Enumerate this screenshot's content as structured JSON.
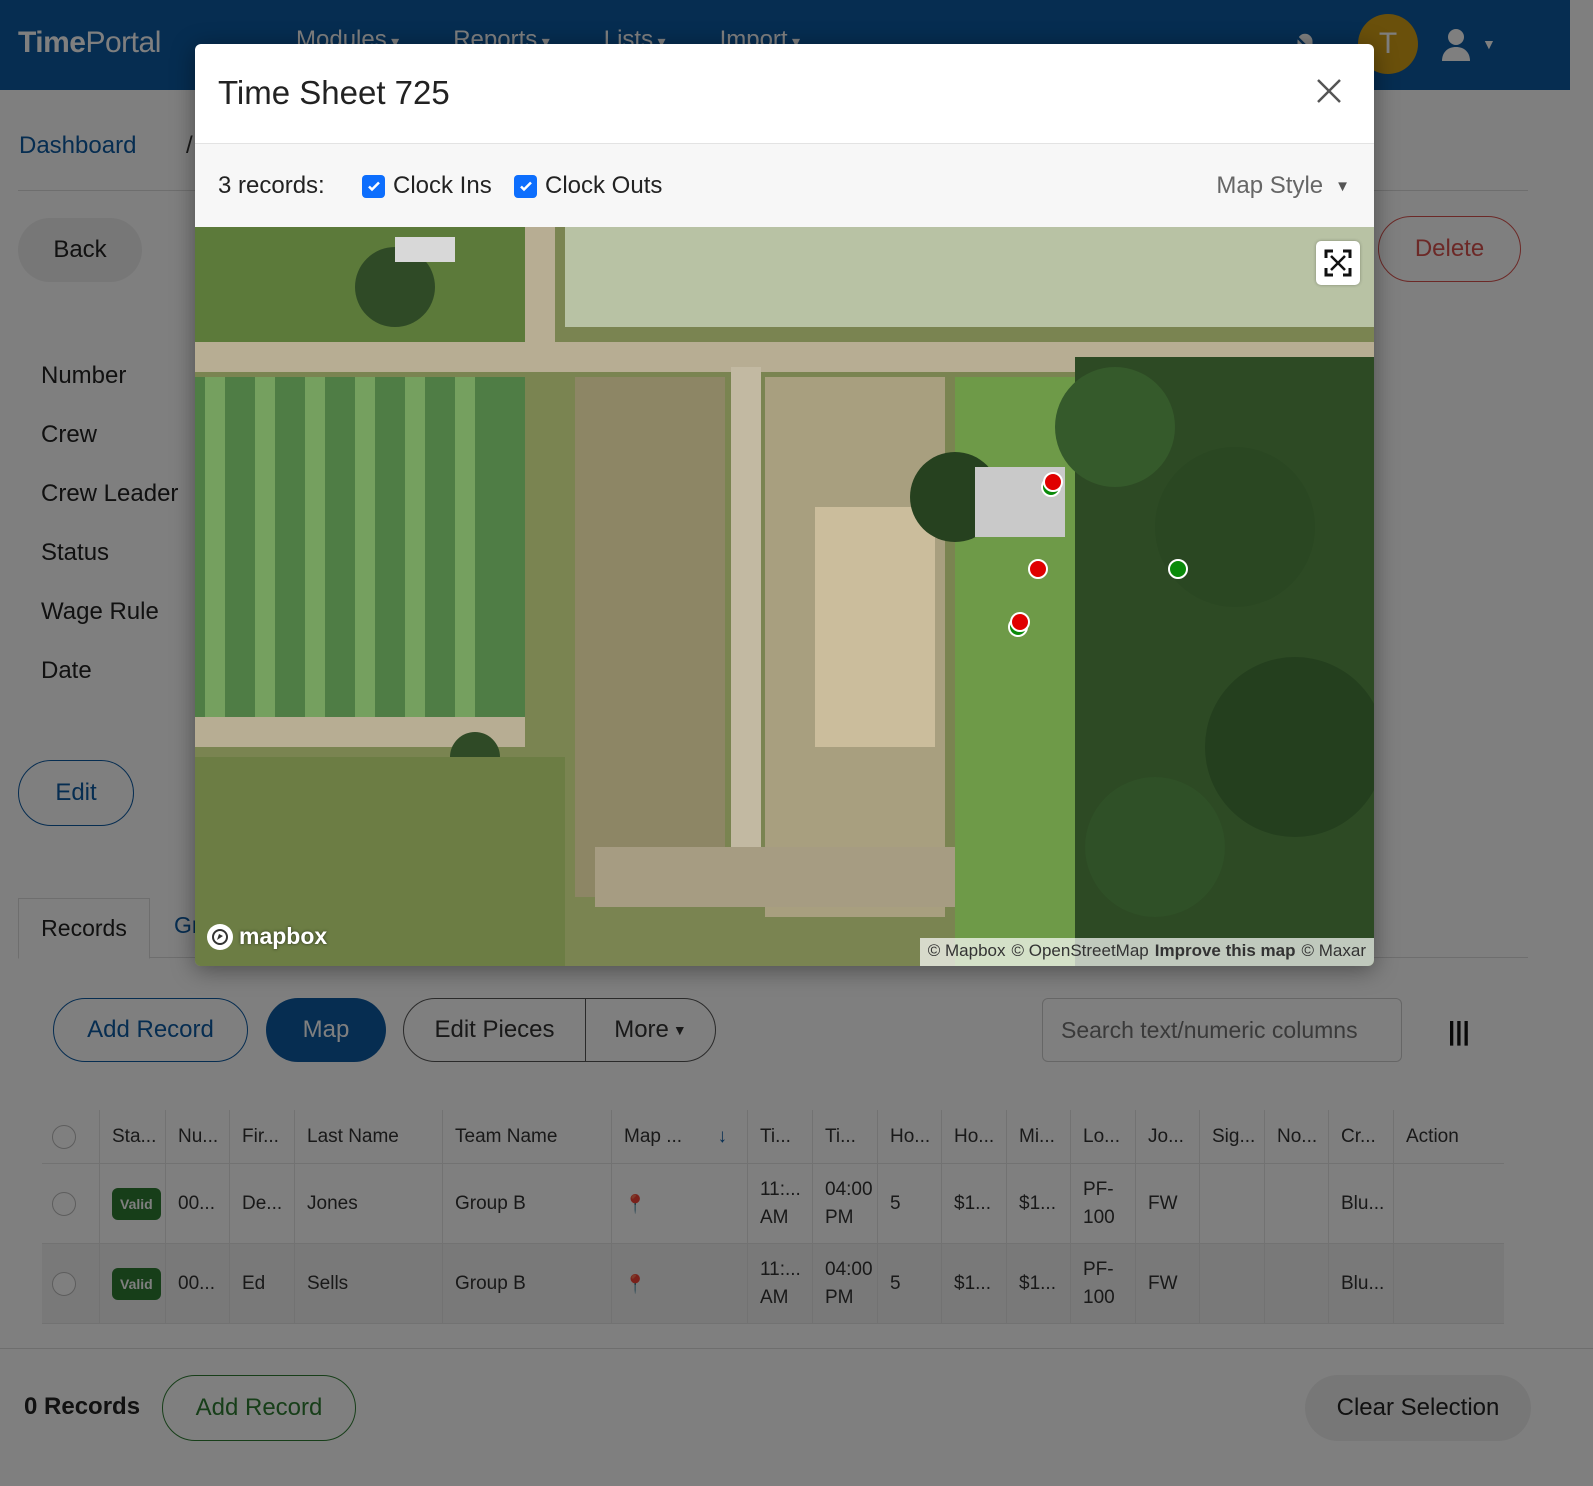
{
  "app": {
    "brand_part1": "Time",
    "brand_part2": "Portal",
    "nav": [
      "Modules",
      "Reports",
      "Lists",
      "Import"
    ],
    "avatar_letter": "T"
  },
  "breadcrumb": {
    "home": "Dashboard",
    "separator": "/"
  },
  "actions": {
    "back": "Back",
    "delete": "Delete",
    "edit": "Edit"
  },
  "fields": [
    "Number",
    "Crew",
    "Crew Leader",
    "Status",
    "Wage Rule",
    "Date"
  ],
  "tabs": {
    "records": "Records",
    "second_partial": "Gr"
  },
  "records_toolbar": {
    "add_record": "Add Record",
    "map": "Map",
    "edit_pieces": "Edit Pieces",
    "more": "More",
    "search_placeholder": "Search text/numeric columns"
  },
  "table": {
    "headers": [
      "Sta...",
      "Nu...",
      "Fir...",
      "Last Name",
      "Team Name",
      "Map ...",
      "Ti...",
      "Ti...",
      "Ho...",
      "Ho...",
      "Mi...",
      "Lo...",
      "Jo...",
      "Sig...",
      "No...",
      "Cr...",
      "Action"
    ],
    "rows": [
      {
        "status": "Valid",
        "number": "00...",
        "first": "De...",
        "last": "Jones",
        "team": "Group B",
        "time_in_1": "11:...",
        "time_in_2": "AM",
        "time_out_1": "04:00",
        "time_out_2": "PM",
        "hours": "5",
        "ho2": "$1...",
        "mi": "$1...",
        "loc_1": "PF-",
        "loc_2": "100",
        "job": "FW",
        "sig": "",
        "notes": "",
        "crew": "Blu...",
        "action": ""
      },
      {
        "status": "Valid",
        "number": "00...",
        "first": "Ed",
        "last": "Sells",
        "team": "Group B",
        "time_in_1": "11:...",
        "time_in_2": "AM",
        "time_out_1": "04:00",
        "time_out_2": "PM",
        "hours": "5",
        "ho2": "$1...",
        "mi": "$1...",
        "loc_1": "PF-",
        "loc_2": "100",
        "job": "FW",
        "sig": "",
        "notes": "",
        "crew": "Blu...",
        "action": ""
      }
    ]
  },
  "footer": {
    "count": "0 Records",
    "add_record": "Add Record",
    "clear": "Clear Selection"
  },
  "modal": {
    "title": "Time Sheet 725",
    "records_label": "3 records:",
    "clock_ins_label": "Clock Ins",
    "clock_outs_label": "Clock Outs",
    "clock_ins_checked": true,
    "clock_outs_checked": true,
    "map_style_label": "Map Style",
    "mapbox_logo": "mapbox",
    "attribution": [
      "© Mapbox",
      "© OpenStreetMap",
      "Improve this map",
      "© Maxar"
    ],
    "marker_colors": {
      "clock_in": "#0a8a0a",
      "clock_out": "#e00000"
    }
  },
  "colors": {
    "primary": "#0d5aa3",
    "danger": "#d9534f",
    "success": "#2e7d32",
    "avatar": "#d4a017"
  }
}
